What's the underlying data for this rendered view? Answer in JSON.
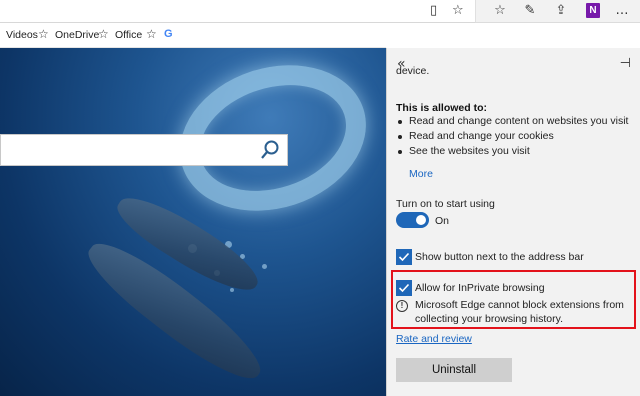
{
  "toolbar": {
    "icons": [
      "reading-view-icon",
      "favorite-star-icon",
      "favorites-hub-icon",
      "web-note-icon",
      "share-icon",
      "onenote-icon",
      "more-icon"
    ],
    "onenote_glyph": "N"
  },
  "favorites_bar": {
    "items": [
      {
        "label": "Videos"
      },
      {
        "label": "OneDrive"
      },
      {
        "label": "Office"
      },
      {
        "label": "G"
      }
    ]
  },
  "panel": {
    "truncated_text": "device.",
    "allowed_heading": "This is allowed to:",
    "permissions": [
      "Read and change content on websites you visit",
      "Read and change your cookies",
      "See the websites you visit"
    ],
    "more_link": "More",
    "toggle_heading": "Turn on to start using",
    "toggle_state": "On",
    "show_button_label": "Show button next to the address bar",
    "inprivate_label": "Allow for InPrivate browsing",
    "info_text": "Microsoft Edge cannot block extensions from collecting your browsing history.",
    "review_link": "Rate and review",
    "uninstall_label": "Uninstall"
  },
  "colors": {
    "accent": "#1f67b8",
    "link": "#1a66c2",
    "highlight_border": "#e3121b",
    "panel_bg": "#f2f2f2"
  }
}
